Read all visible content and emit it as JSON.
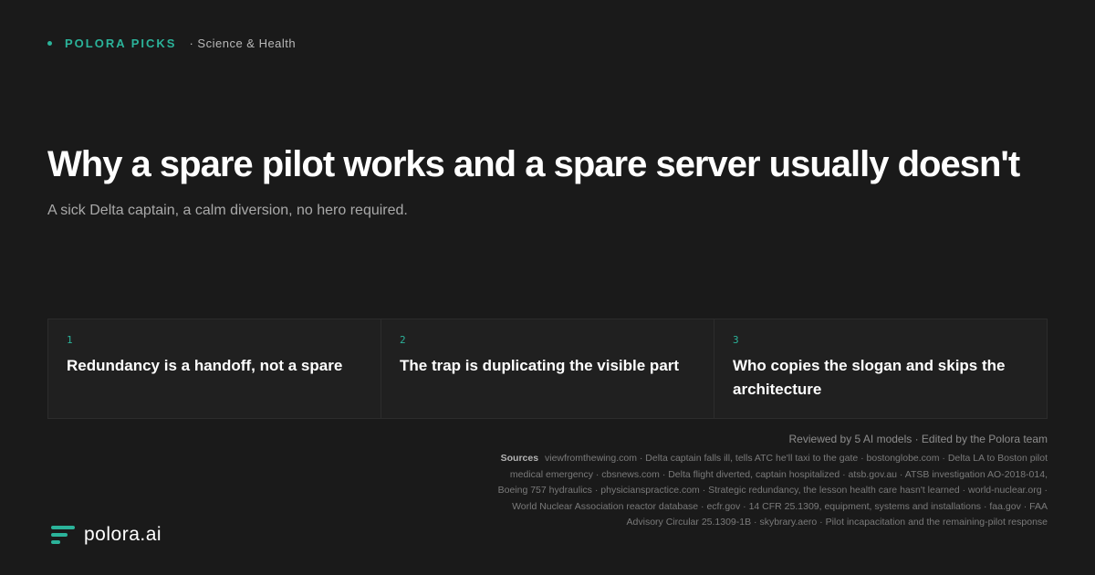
{
  "brand": {
    "name": "POLORA PICKS",
    "category": "· Science & Health",
    "accent": "#2bb39a"
  },
  "headline": "Why a spare pilot works and a spare server usually doesn't",
  "subheadline": "A sick Delta captain, a calm diversion, no hero required.",
  "cards": [
    {
      "number": "1",
      "text": "Redundancy is a handoff, not a spare"
    },
    {
      "number": "2",
      "text": "The trap is duplicating the visible part"
    },
    {
      "number": "3",
      "text": "Who copies the slogan and skips the architecture"
    }
  ],
  "footer": {
    "reviewed": "Reviewed by 5 AI models · Edited by the Polora team",
    "sources_label": "Sources",
    "sources_text": "viewfromthewing.com · Delta captain falls ill, tells ATC he'll taxi to the gate · bostonglobe.com · Delta LA to Boston pilot medical emergency · cbsnews.com · Delta flight diverted, captain hospitalized · atsb.gov.au · ATSB investigation AO-2018-014, Boeing 757 hydraulics · physicianspractice.com · Strategic redundancy, the lesson health care hasn't learned · world-nuclear.org · World Nuclear Association reactor database · ecfr.gov · 14 CFR 25.1309, equipment, systems and installations · faa.gov · FAA Advisory Circular 25.1309-1B · skybrary.aero · Pilot incapacitation and the remaining-pilot response"
  },
  "logo": {
    "text": "polora.ai",
    "icon": "polora-logo-icon"
  }
}
